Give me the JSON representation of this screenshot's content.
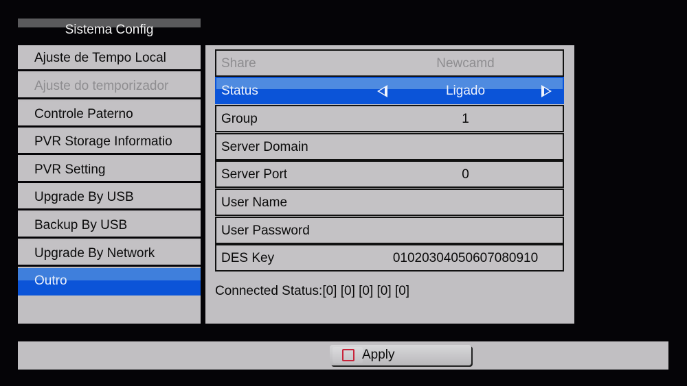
{
  "title": "Sistema Config",
  "sidebar": {
    "items": [
      {
        "label": "Ajuste de Tempo Local",
        "state": "normal"
      },
      {
        "label": "Ajuste do temporizador",
        "state": "disabled"
      },
      {
        "label": "Controle Paterno",
        "state": "normal"
      },
      {
        "label": "PVR Storage Informatio",
        "state": "normal"
      },
      {
        "label": "PVR Setting",
        "state": "normal"
      },
      {
        "label": "Upgrade By USB",
        "state": "normal"
      },
      {
        "label": "Backup By USB",
        "state": "normal"
      },
      {
        "label": "Upgrade By Network",
        "state": "normal"
      },
      {
        "label": "Outro",
        "state": "selected"
      }
    ]
  },
  "panel": {
    "rows": [
      {
        "label": "Share",
        "value": "Newcamd",
        "state": "disabled"
      },
      {
        "label": "Status",
        "value": "Ligado",
        "state": "selected"
      },
      {
        "label": "Group",
        "value": "1",
        "state": "normal"
      },
      {
        "label": "Server Domain",
        "value": "",
        "state": "normal"
      },
      {
        "label": "Server Port",
        "value": "0",
        "state": "normal"
      },
      {
        "label": "User Name",
        "value": "",
        "state": "normal"
      },
      {
        "label": "User Password",
        "value": "",
        "state": "normal"
      },
      {
        "label": "DES Key",
        "value": "01020304050607080910",
        "state": "normal"
      }
    ],
    "connected_status": "Connected Status:[0] [0] [0] [0] [0]"
  },
  "footer": {
    "apply_label": "Apply",
    "apply_key_icon": "red-square-icon"
  },
  "colors": {
    "highlight": "#0b54d8",
    "panel_bg": "#c1bfc2",
    "background": "#050407",
    "apply_key": "#c8243a"
  }
}
